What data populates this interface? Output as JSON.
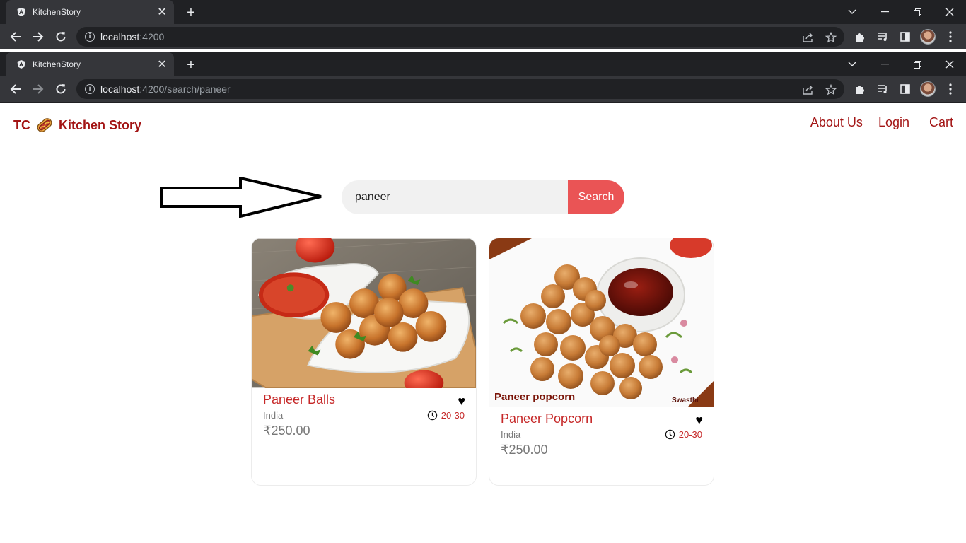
{
  "browser_back": {
    "tab_title": "KitchenStory",
    "url_host": "localhost",
    "url_path": ":4200"
  },
  "browser_front": {
    "tab_title": "KitchenStory",
    "url_host": "localhost",
    "url_path": ":4200/search/paneer"
  },
  "icons": {
    "favicon": "angular-icon",
    "close": "close-icon",
    "new_tab": "plus-icon",
    "back": "arrow-left-icon",
    "forward": "arrow-right-icon",
    "reload": "reload-icon",
    "share": "share-icon",
    "bookmark": "star-icon",
    "extensions": "puzzle-icon",
    "media": "media-queue-icon",
    "side_panel": "side-panel-icon",
    "menu": "kebab-menu-icon"
  },
  "navbar": {
    "brand_prefix": "TC",
    "brand_name": "Kitchen Story",
    "links": [
      "About Us",
      "Login",
      "Cart"
    ]
  },
  "search": {
    "value": "paneer",
    "button": "Search"
  },
  "colors": {
    "brand": "#a31515",
    "search_button": "#ea5455",
    "title_red": "#c62828"
  },
  "results": [
    {
      "title": "Paneer Balls",
      "origin": "India",
      "time": "20-30",
      "price": "₹250.00",
      "favorite": "♥"
    },
    {
      "title": "Paneer Popcorn",
      "origin": "India",
      "time": "20-30",
      "price": "₹250.00",
      "favorite": "♥",
      "image_caption": "Paneer popcorn",
      "image_watermark": "Swasthi"
    }
  ]
}
